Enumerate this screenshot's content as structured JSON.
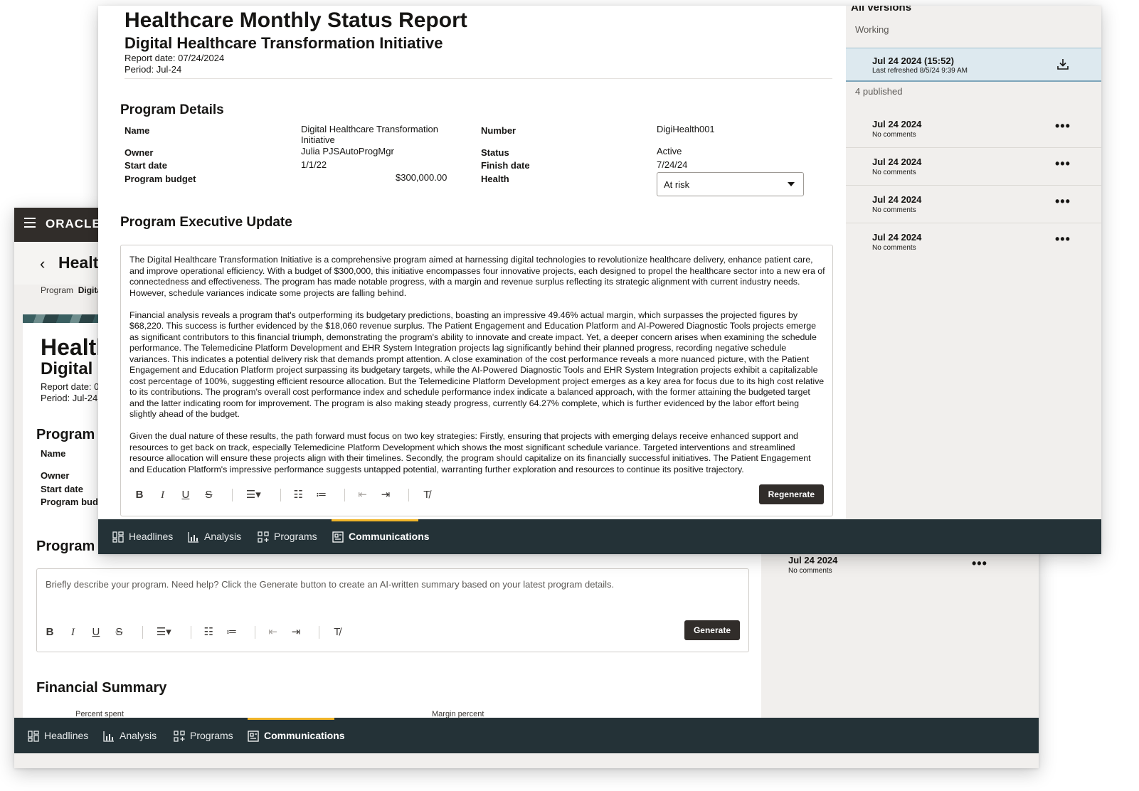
{
  "back": {
    "brand": "ORACLE",
    "app_title": "Healt",
    "breadcrumb_label": "Program",
    "breadcrumb_value": "Digital",
    "report_title": "Health",
    "report_subtitle": "Digital H",
    "report_date": "Report date: 0",
    "period": "Period: Jul-24",
    "program_details_heading": "Program D",
    "labels": [
      "Name",
      "Owner",
      "Start date",
      "Program budg"
    ],
    "exec_update_heading": "Program E",
    "editor_placeholder": "Briefly describe your program. Need help? Click the Generate button to create an AI-written summary based on your latest program details.",
    "generate_label": "Generate",
    "financial_summary_heading": "Financial Summary",
    "percent_spent": "Percent spent",
    "margin_percent": "Margin percent",
    "side_version": {
      "date": "Jul 24 2024",
      "comments": "No comments",
      "menu": "•••"
    }
  },
  "nav": {
    "items": [
      {
        "label": "Headlines",
        "icon": "headlines-icon"
      },
      {
        "label": "Analysis",
        "icon": "analysis-icon"
      },
      {
        "label": "Programs",
        "icon": "programs-icon"
      },
      {
        "label": "Communications",
        "icon": "communications-icon"
      }
    ],
    "active": "Communications"
  },
  "front": {
    "report_title": "Healthcare Monthly Status Report",
    "report_subtitle": "Digital Healthcare Transformation Initiative",
    "report_date": "Report date: 07/24/2024",
    "period": "Period: Jul-24",
    "program_details_heading": "Program Details",
    "details": {
      "name_label": "Name",
      "name_value_line1": "Digital Healthcare Transformation",
      "name_value_line2": "Initiative",
      "owner_label": "Owner",
      "owner_value": "Julia PJSAutoProgMgr",
      "start_label": "Start date",
      "start_value": "1/1/22",
      "budget_label": "Program budget",
      "budget_value": "$300,000.00",
      "number_label": "Number",
      "number_value": "DigiHealth001",
      "status_label": "Status",
      "status_value": "Active",
      "finish_label": "Finish date",
      "finish_value": "7/24/24",
      "health_label": "Health",
      "health_value": "At risk"
    },
    "exec_update_heading": "Program Executive Update",
    "paragraphs": [
      "The Digital Healthcare Transformation Initiative is a comprehensive program aimed at harnessing digital technologies to revolutionize healthcare delivery, enhance patient care, and improve operational efficiency. With a budget of $300,000, this initiative encompasses four innovative projects, each designed to propel the healthcare sector into a new era of connectedness and effectiveness. The program has made notable progress, with a margin and revenue surplus reflecting its strategic alignment with current industry needs. However, schedule variances indicate some projects are falling behind.",
      "Financial analysis reveals a program that's outperforming its budgetary predictions, boasting an impressive 49.46% actual margin, which surpasses the projected figures by $68,220. This success is further evidenced by the $18,060 revenue surplus. The Patient Engagement and Education Platform and AI-Powered Diagnostic Tools projects emerge as significant contributors to this financial triumph, demonstrating the program's ability to innovate and create impact. Yet, a deeper concern arises when examining the schedule performance. The Telemedicine Platform Development and EHR System Integration projects lag significantly behind their planned progress, recording negative schedule variances. This indicates a potential delivery risk that demands prompt attention. A close examination of the cost performance reveals a more nuanced picture, with the Patient Engagement and Education Platform project surpassing its budgetary targets, while the AI-Powered Diagnostic Tools and EHR System Integration projects exhibit a capitalizable cost percentage of 100%, suggesting efficient resource allocation. But the Telemedicine Platform Development project emerges as a key area for focus due to its high cost relative to its contributions. The program's overall cost performance index and schedule performance index indicate a balanced approach, with the former attaining the budgeted target and the latter indicating room for improvement. The program is also making steady progress, currently 64.27% complete, which is further evidenced by the labor effort being slightly ahead of the budget.",
      "Given the dual nature of these results, the path forward must focus on two key strategies: Firstly, ensuring that projects with emerging delays receive enhanced support and resources to get back on track, especially Telemedicine Platform Development which shows the most significant schedule variance. Targeted interventions and streamlined resource allocation will ensure these projects align with their timelines. Secondly, the program should capitalize on its financially successful initiatives. The Patient Engagement and Education Platform's impressive performance suggests untapped potential, warranting further exploration and resources to continue its positive trajectory."
    ],
    "regenerate_label": "Regenerate",
    "versions": {
      "heading": "All versions",
      "working_label": "Working",
      "working_item": {
        "date": "Jul 24 2024 (15:52)",
        "refreshed": "Last refreshed 8/5/24 9:39 AM"
      },
      "published_label": "4 published",
      "published": [
        {
          "date": "Jul 24 2024",
          "comments": "No comments"
        },
        {
          "date": "Jul 24 2024",
          "comments": "No comments"
        },
        {
          "date": "Jul 24 2024",
          "comments": "No comments"
        },
        {
          "date": "Jul 24 2024",
          "comments": "No comments"
        }
      ],
      "menu": "•••"
    }
  },
  "toolbar_glyphs": {
    "bold": "B",
    "italic": "I",
    "underline": "U",
    "strike": "S"
  }
}
